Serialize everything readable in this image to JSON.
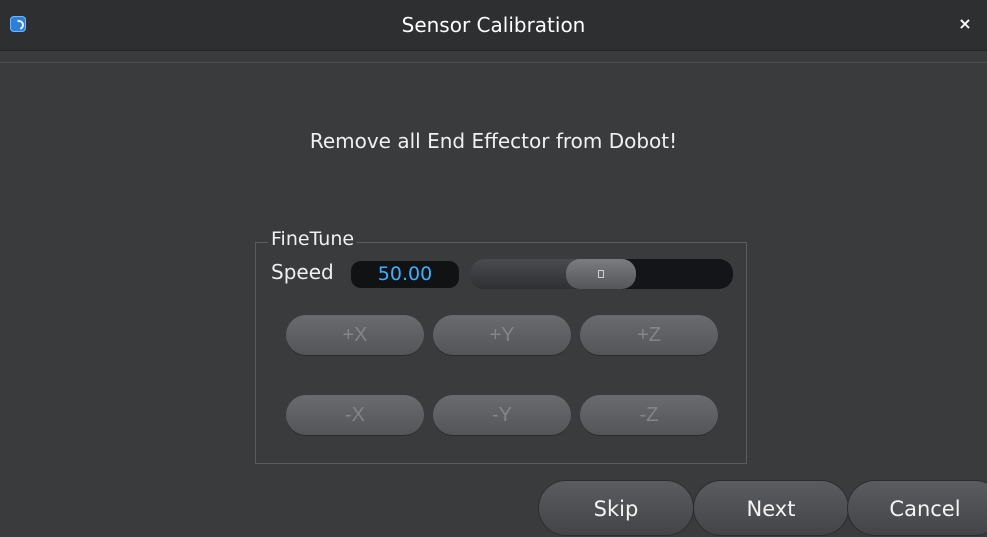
{
  "window": {
    "title": "Sensor Calibration",
    "close_glyph": "×"
  },
  "message": "Remove all End Effector from Dobot!",
  "finetune": {
    "label": "FineTune",
    "speed_label": "Speed",
    "speed_value": "50.00",
    "slider_level": 0.45,
    "buttons_row1": [
      "+X",
      "+Y",
      "+Z"
    ],
    "buttons_row2": [
      "-X",
      "-Y",
      "-Z"
    ]
  },
  "footer": {
    "skip": "Skip",
    "next": "Next",
    "cancel": "Cancel"
  },
  "colors": {
    "background": "#3a3b3d",
    "titlebar": "#2e2f31",
    "speed_text": "#3ab0ff",
    "disabled_text": "#848588"
  }
}
